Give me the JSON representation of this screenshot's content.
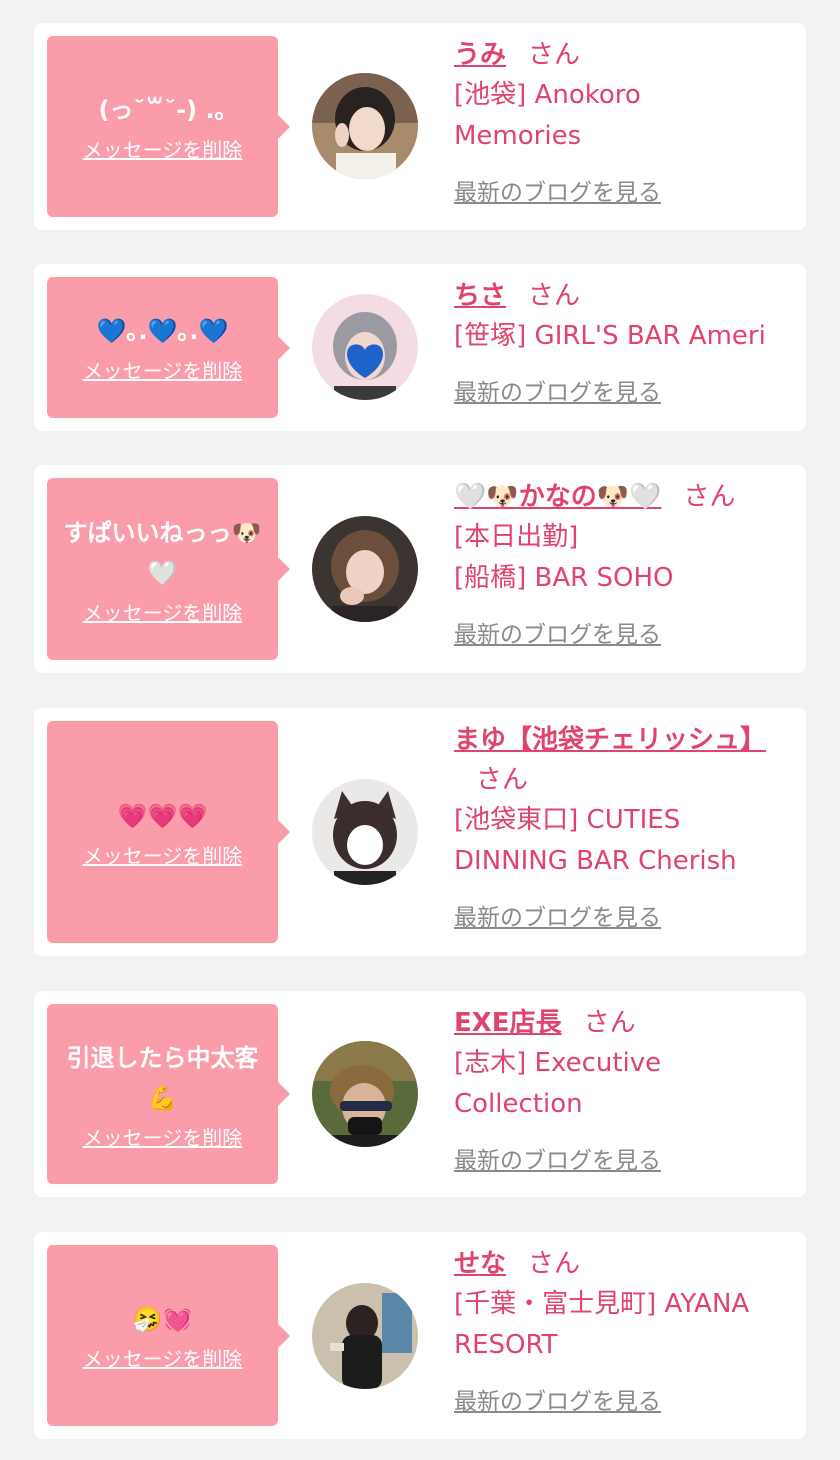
{
  "colors": {
    "background": "#f2f2f2",
    "card": "#ffffff",
    "bubble": "#fb9cab",
    "name_pink": "#e0436b",
    "link_gray": "#8a8a8a"
  },
  "messages": [
    {
      "message": "(っ˘꒳˘-) .｡",
      "delete_label": "メッセージを削除",
      "name": "うみ",
      "suffix": "さん",
      "shop_lines": [
        "[池袋] Anokoro",
        "Memories"
      ],
      "blog_label": "最新のブログを見る",
      "avatar_icon": "user-photo-icon"
    },
    {
      "message": "💙｡.💙｡.💙",
      "delete_label": "メッセージを削除",
      "name": "ちさ",
      "suffix": "さん",
      "shop_lines": [
        "[笹塚] GIRL'S BAR Ameri"
      ],
      "blog_label": "最新のブログを見る",
      "avatar_icon": "user-photo-icon"
    },
    {
      "message": "すぱいいねっっ🐶🤍",
      "delete_label": "メッセージを削除",
      "name": "🤍🐶かなの🐶🤍",
      "suffix": "さん",
      "shop_lines": [
        "[本日出勤]",
        "[船橋] BAR SOHO"
      ],
      "blog_label": "最新のブログを見る",
      "avatar_icon": "user-photo-icon"
    },
    {
      "message": "💗💗💗",
      "delete_label": "メッセージを削除",
      "name": "まゆ【池袋チェリッシュ】",
      "suffix": "さん",
      "shop_lines": [
        "[池袋東口] CUTIES",
        "DINNING BAR Cherish"
      ],
      "blog_label": "最新のブログを見る",
      "avatar_icon": "user-photo-icon"
    },
    {
      "message": "引退したら中太客💪",
      "delete_label": "メッセージを削除",
      "name": "EXE店長",
      "suffix": "さん",
      "shop_lines": [
        "[志木] Executive",
        "Collection"
      ],
      "blog_label": "最新のブログを見る",
      "avatar_icon": "user-photo-icon"
    },
    {
      "message": "🤧💓",
      "delete_label": "メッセージを削除",
      "name": "せな",
      "suffix": "さん",
      "shop_lines": [
        "[千葉・富士見町] AYANA",
        "RESORT"
      ],
      "blog_label": "最新のブログを見る",
      "avatar_icon": "user-photo-icon"
    }
  ]
}
